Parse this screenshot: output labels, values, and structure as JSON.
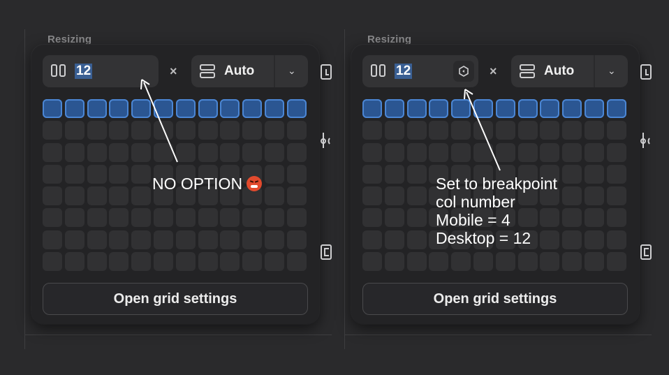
{
  "panels": [
    {
      "section_label": "Resizing",
      "columns_value": "12",
      "times_symbol": "×",
      "rows_value": "Auto",
      "button_label": "Open grid settings",
      "annotation_lines": [
        "NO OPTION"
      ]
    },
    {
      "section_label": "Resizing",
      "columns_value": "12",
      "times_symbol": "×",
      "rows_value": "Auto",
      "button_label": "Open grid settings",
      "annotation_lines": [
        "Set to breakpoint",
        "col number",
        "Mobile = 4",
        "Desktop = 12"
      ]
    }
  ],
  "grid": {
    "columns": 12,
    "rows": 8,
    "highlighted_rows": 1
  },
  "colors": {
    "background": "#2a2a2c",
    "accent": "#4b86d4",
    "selection": "#3a5f93"
  },
  "icons": [
    "columns-icon",
    "rows-icon",
    "chevron-down-icon",
    "breakpoint-link-icon",
    "angry-face-emoji"
  ]
}
